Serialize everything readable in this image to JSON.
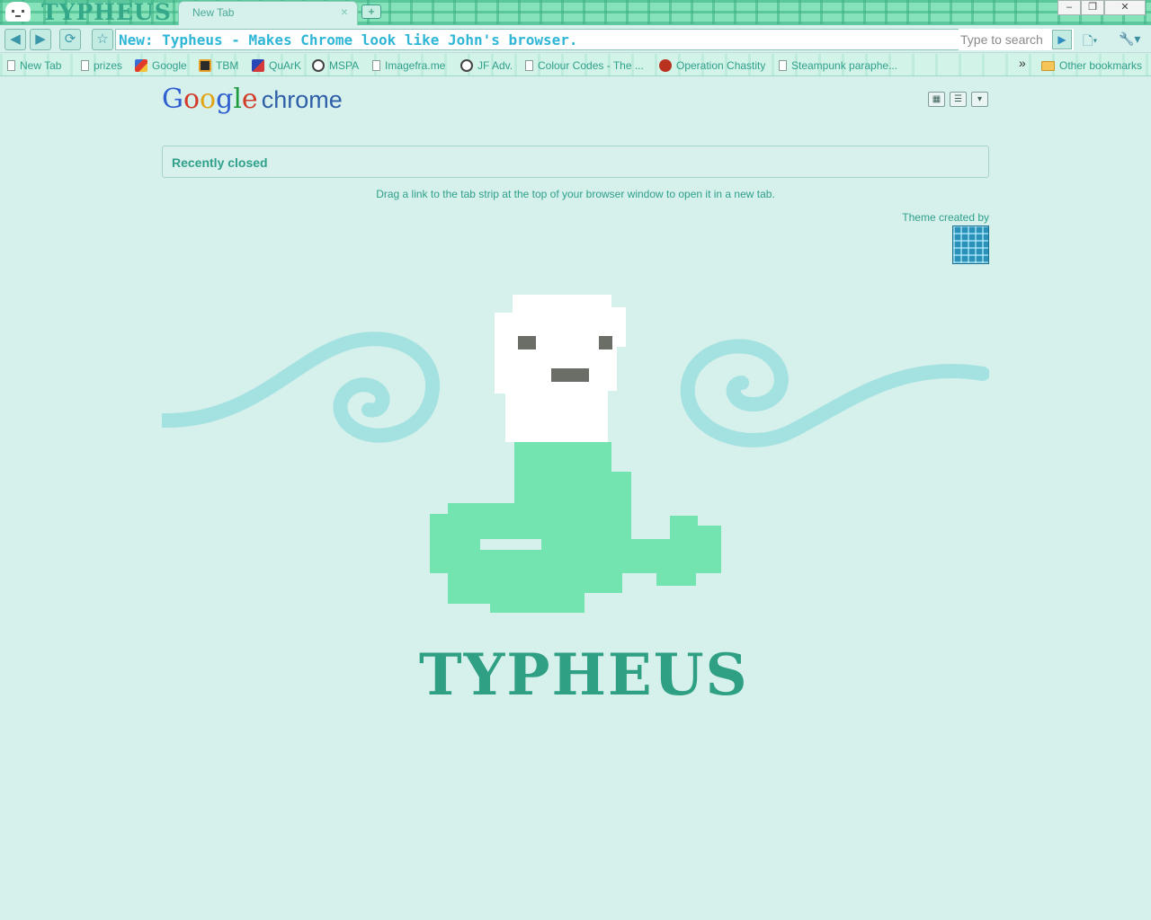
{
  "window": {
    "brand_text": "TYPHEUS",
    "tab": {
      "title": "New Tab",
      "close": "×"
    },
    "new_tab_glyph": "+",
    "controls": {
      "minimize": "–",
      "maximize": "❐",
      "close": "✕"
    }
  },
  "toolbar": {
    "back_icon": "back-arrow-icon",
    "forward_icon": "forward-arrow-icon",
    "reload_icon": "reload-icon",
    "star_icon": "star-icon",
    "address_text": "New: Typheus - Makes Chrome look like John's browser.",
    "search_placeholder": "Type to search",
    "go_glyph": "▶",
    "page_menu_glyph": "🗋▾",
    "wrench_menu_glyph": "🔧▾"
  },
  "bookmarks": {
    "items": [
      {
        "label": "New Tab"
      },
      {
        "label": "prizes"
      },
      {
        "label": "Google"
      },
      {
        "label": "TBM"
      },
      {
        "label": "QuArK"
      },
      {
        "label": "MSPA"
      },
      {
        "label": "Imagefra.me"
      },
      {
        "label": "JF Adv."
      },
      {
        "label": "Colour Codes - The ..."
      },
      {
        "label": "Operation Chastity"
      },
      {
        "label": "Steampunk paraphe..."
      }
    ],
    "overflow": "»",
    "other": "Other bookmarks"
  },
  "ntp": {
    "logo": {
      "g1": "G",
      "g2": "o",
      "g3": "o",
      "g4": "g",
      "g5": "l",
      "g6": "e",
      "chrome": "chrome"
    },
    "recently_closed": "Recently closed",
    "hint": "Drag a link to the tab strip at the top of your browser window to open it in a new tab.",
    "theme_credit": "Theme created by"
  },
  "theme": {
    "wordmark": "TYPHEUS",
    "colors": {
      "background": "#d6f0ec",
      "accent_text": "#2fa08a",
      "wind": "#a4e2e1",
      "serpent": "#73e4b0",
      "frame": "#86e3b9"
    }
  }
}
